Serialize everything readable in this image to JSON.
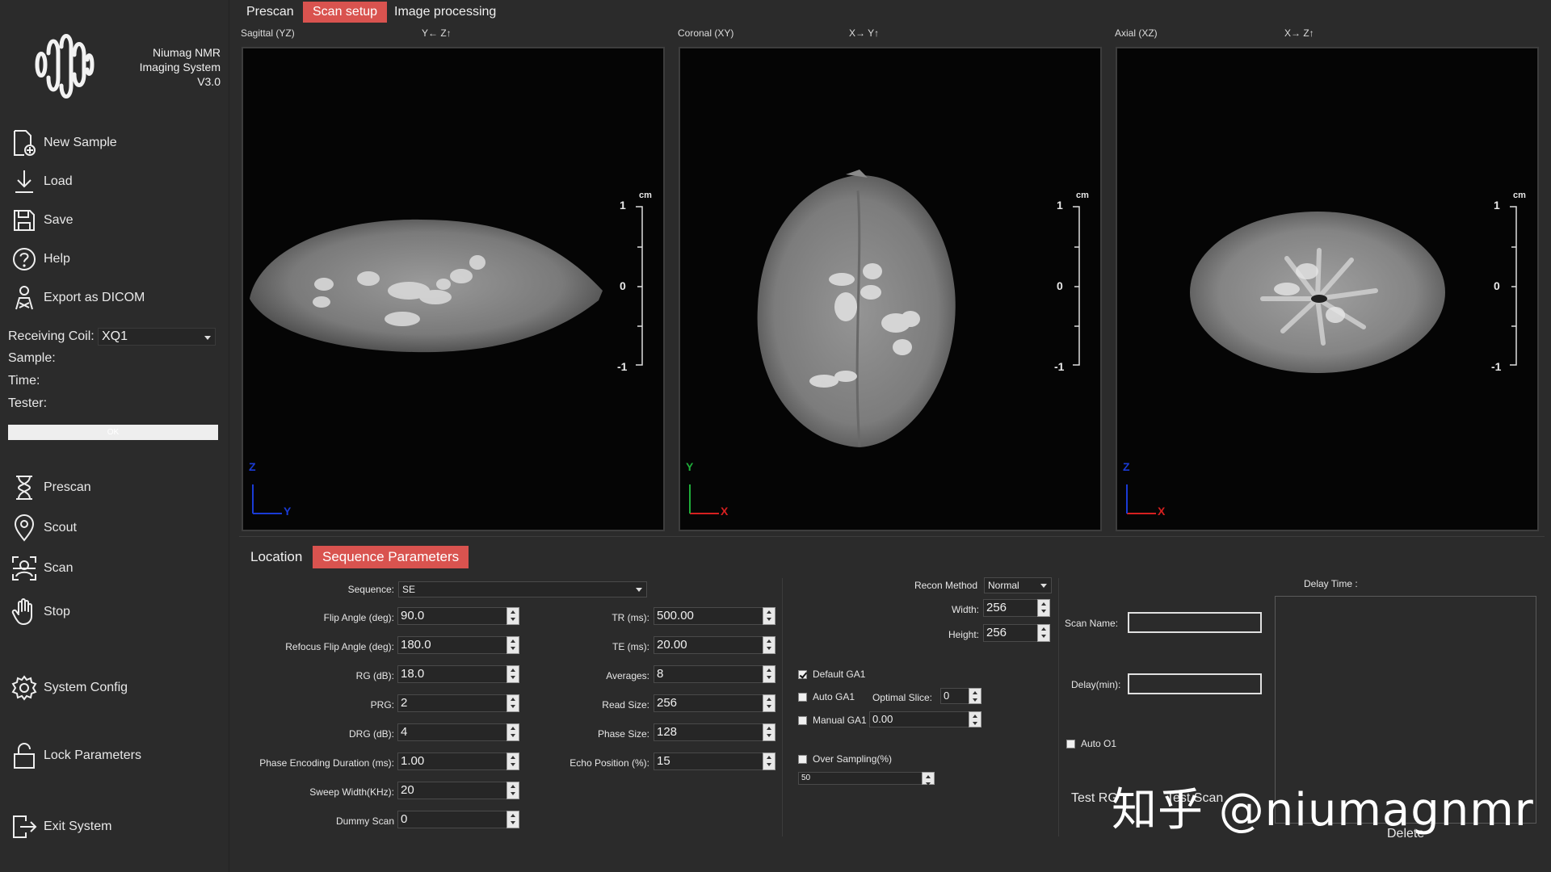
{
  "app": {
    "name_line1": "Niumag NMR",
    "name_line2": "Imaging System",
    "version": "V3.0"
  },
  "sidebar": {
    "file_items": [
      {
        "label": "New Sample",
        "icon": "new-file-icon"
      },
      {
        "label": "Load",
        "icon": "download-icon"
      },
      {
        "label": "Save",
        "icon": "floppy-icon"
      },
      {
        "label": "Help",
        "icon": "help-icon"
      },
      {
        "label": "Export as DICOM",
        "icon": "export-dicom-icon"
      }
    ],
    "receiving_coil_label": "Receiving Coil:",
    "receiving_coil_value": "XQ1",
    "sample_label": "Sample:",
    "time_label": "Time:",
    "tester_label": "Tester:",
    "ok_label": "OK",
    "scan_items": [
      {
        "label": "Prescan",
        "icon": "hourglass-icon"
      },
      {
        "label": "Scout",
        "icon": "pin-icon"
      },
      {
        "label": "Scan",
        "icon": "scan-icon"
      },
      {
        "label": "Stop",
        "icon": "hand-icon"
      }
    ],
    "system_config": "System Config",
    "lock_parameters": "Lock Parameters",
    "exit_system": "Exit System"
  },
  "top_tabs": [
    {
      "label": "Prescan",
      "active": false
    },
    {
      "label": "Scan setup",
      "active": true
    },
    {
      "label": "Image processing",
      "active": false
    }
  ],
  "viewports": [
    {
      "title": "Sagittal (YZ)",
      "axes": "Y← Z↑",
      "h_axis": "Y",
      "v_axis": "Z",
      "h_color": "#1a3bd6",
      "v_color": "#1a3bd6"
    },
    {
      "title": "Coronal (XY)",
      "axes": "X→ Y↑",
      "h_axis": "X",
      "v_axis": "Y",
      "h_color": "#d62020",
      "v_color": "#1fae3a"
    },
    {
      "title": "Axial (XZ)",
      "axes": "X→ Z↑",
      "h_axis": "X",
      "v_axis": "Z",
      "h_color": "#d62020",
      "v_color": "#1a3bd6"
    }
  ],
  "scale": {
    "unit": "cm",
    "top": "1",
    "mid": "0",
    "bottom": "-1"
  },
  "sub_tabs": [
    {
      "label": "Location",
      "active": false
    },
    {
      "label": "Sequence Parameters",
      "active": true
    }
  ],
  "params": {
    "sequence_label": "Sequence:",
    "sequence_value": "SE",
    "left": [
      {
        "label": "Flip Angle (deg):",
        "value": "90.0"
      },
      {
        "label": "Refocus Flip Angle (deg):",
        "value": "180.0"
      },
      {
        "label": "RG (dB):",
        "value": "18.0"
      },
      {
        "label": "PRG:",
        "value": "2"
      },
      {
        "label": "DRG (dB):",
        "value": "4"
      },
      {
        "label": "Phase Encoding Duration (ms):",
        "value": "1.00"
      },
      {
        "label": "Sweep Width(KHz):",
        "value": "20"
      },
      {
        "label": "Dummy Scan",
        "value": "0"
      }
    ],
    "right": [
      {
        "label": "TR (ms):",
        "value": "500.00"
      },
      {
        "label": "TE (ms):",
        "value": "20.00"
      },
      {
        "label": "Averages:",
        "value": "8"
      },
      {
        "label": "Read Size:",
        "value": "256"
      },
      {
        "label": "Phase Size:",
        "value": "128"
      },
      {
        "label": "Echo Position (%):",
        "value": "15"
      }
    ]
  },
  "recon": {
    "method_label": "Recon Method",
    "method_value": "Normal",
    "width_label": "Width:",
    "width_value": "256",
    "height_label": "Height:",
    "height_value": "256",
    "default_ga1": "Default GA1",
    "auto_ga1": "Auto GA1",
    "optimal_slice_label": "Optimal Slice:",
    "optimal_slice_value": "0",
    "manual_ga1": "Manual GA1",
    "manual_ga1_value": "0.00",
    "over_sampling": "Over Sampling(%)",
    "over_sampling_value": "50"
  },
  "scan_panel": {
    "scan_name_label": "Scan Name:",
    "delay_label": "Delay(min):",
    "auto_o1": "Auto O1",
    "test_rg": "Test RG",
    "test_scan": "Test Scan",
    "delay_time_label": "Delay Time :",
    "delete": "Delete"
  },
  "watermark": "知乎 @niumagnmr"
}
